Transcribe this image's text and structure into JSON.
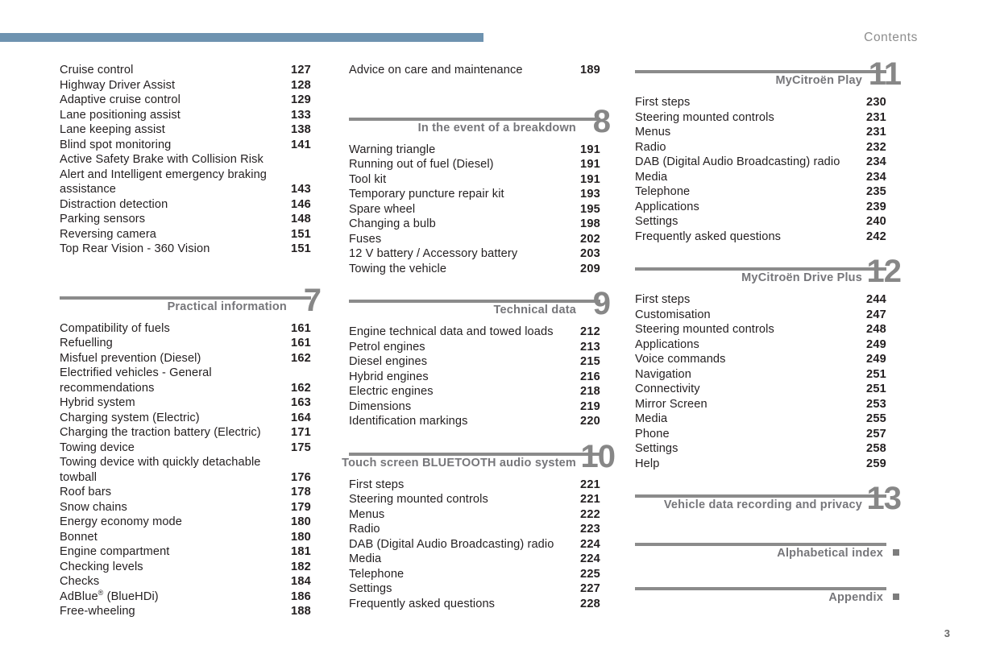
{
  "header": {
    "title": "Contents",
    "bar_color": "#6e93b0"
  },
  "footer": {
    "page_number": "3"
  },
  "columns": [
    {
      "id": "column-1",
      "blocks": [
        {
          "type": "entries",
          "entries": [
            {
              "label": "Cruise control",
              "page": "127"
            },
            {
              "label": "Highway Driver Assist",
              "page": "128"
            },
            {
              "label": "Adaptive cruise control",
              "page": "129"
            },
            {
              "label": "Lane positioning assist",
              "page": "133"
            },
            {
              "label": "Lane keeping assist",
              "page": "138"
            },
            {
              "label": "Blind spot monitoring",
              "page": "141"
            },
            {
              "label": "Active Safety Brake with Collision Risk",
              "page": ""
            },
            {
              "label": "Alert and Intelligent emergency braking",
              "page": ""
            },
            {
              "label": "assistance",
              "page": "143"
            },
            {
              "label": "Distraction detection",
              "page": "146"
            },
            {
              "label": "Parking sensors",
              "page": "148"
            },
            {
              "label": "Reversing camera",
              "page": "151"
            },
            {
              "label": "Top Rear Vision - 360 Vision",
              "page": "151"
            }
          ]
        },
        {
          "type": "chapter",
          "title": "Practical information",
          "number": "7",
          "entries": [
            {
              "label": "Compatibility of fuels",
              "page": "161"
            },
            {
              "label": "Refuelling",
              "page": "161"
            },
            {
              "label": "Misfuel prevention (Diesel)",
              "page": "162"
            },
            {
              "label": "Electrified vehicles - General",
              "page": ""
            },
            {
              "label": "recommendations",
              "page": "162"
            },
            {
              "label": "Hybrid system",
              "page": "163"
            },
            {
              "label": "Charging system (Electric)",
              "page": "164"
            },
            {
              "label": "Charging the traction battery (Electric)",
              "page": "171"
            },
            {
              "label": "Towing device",
              "page": "175"
            },
            {
              "label": "Towing device with quickly detachable",
              "page": ""
            },
            {
              "label": "towball",
              "page": "176"
            },
            {
              "label": "Roof bars",
              "page": "178"
            },
            {
              "label": "Snow chains",
              "page": "179"
            },
            {
              "label": "Energy economy mode",
              "page": "180"
            },
            {
              "label": "Bonnet",
              "page": "180"
            },
            {
              "label": "Engine compartment",
              "page": "181"
            },
            {
              "label": "Checking levels",
              "page": "182"
            },
            {
              "label": "Checks",
              "page": "184"
            },
            {
              "label": "AdBlue® (BlueHDi)",
              "page": "186",
              "html": "AdBlue<sup>®</sup> (BlueHDi)"
            },
            {
              "label": "Free-wheeling",
              "page": "188"
            }
          ]
        }
      ]
    },
    {
      "id": "column-2",
      "blocks": [
        {
          "type": "entries",
          "entries": [
            {
              "label": "Advice on care and maintenance",
              "page": "189"
            }
          ]
        },
        {
          "type": "chapter",
          "title": "In the event of a breakdown",
          "number": "8",
          "entries": [
            {
              "label": "Warning triangle",
              "page": "191"
            },
            {
              "label": "Running out of fuel (Diesel)",
              "page": "191"
            },
            {
              "label": "Tool kit",
              "page": "191"
            },
            {
              "label": "Temporary puncture repair kit",
              "page": "193"
            },
            {
              "label": "Spare wheel",
              "page": "195"
            },
            {
              "label": "Changing a bulb",
              "page": "198"
            },
            {
              "label": "Fuses",
              "page": "202"
            },
            {
              "label": "12 V battery / Accessory battery",
              "page": "203"
            },
            {
              "label": "Towing the vehicle",
              "page": "209"
            }
          ]
        },
        {
          "type": "chapter",
          "title": "Technical data",
          "number": "9",
          "entries": [
            {
              "label": "Engine technical data and towed loads",
              "page": "212"
            },
            {
              "label": "Petrol engines",
              "page": "213"
            },
            {
              "label": "Diesel engines",
              "page": "215"
            },
            {
              "label": "Hybrid engines",
              "page": "216"
            },
            {
              "label": "Electric engines",
              "page": "218"
            },
            {
              "label": "Dimensions",
              "page": "219"
            },
            {
              "label": "Identification markings",
              "page": "220"
            }
          ]
        },
        {
          "type": "chapter",
          "title": "Touch screen BLUETOOTH audio system",
          "number": "10",
          "entries": [
            {
              "label": "First steps",
              "page": "221"
            },
            {
              "label": "Steering mounted controls",
              "page": "221"
            },
            {
              "label": "Menus",
              "page": "222"
            },
            {
              "label": "Radio",
              "page": "223"
            },
            {
              "label": "DAB (Digital Audio Broadcasting) radio",
              "page": "224"
            },
            {
              "label": "Media",
              "page": "224"
            },
            {
              "label": "Telephone",
              "page": "225"
            },
            {
              "label": "Settings",
              "page": "227"
            },
            {
              "label": "Frequently asked questions",
              "page": "228"
            }
          ]
        }
      ]
    },
    {
      "id": "column-3",
      "blocks": [
        {
          "type": "chapter",
          "title": "MyCitroën Play",
          "number": "11",
          "entries": [
            {
              "label": "First steps",
              "page": "230"
            },
            {
              "label": "Steering mounted controls",
              "page": "231"
            },
            {
              "label": "Menus",
              "page": "231"
            },
            {
              "label": "Radio",
              "page": "232"
            },
            {
              "label": "DAB (Digital Audio Broadcasting) radio",
              "page": "234"
            },
            {
              "label": "Media",
              "page": "234"
            },
            {
              "label": "Telephone",
              "page": "235"
            },
            {
              "label": "Applications",
              "page": "239"
            },
            {
              "label": "Settings",
              "page": "240"
            },
            {
              "label": "Frequently asked questions",
              "page": "242"
            }
          ]
        },
        {
          "type": "chapter",
          "title": "MyCitroën Drive Plus",
          "number": "12",
          "entries": [
            {
              "label": "First steps",
              "page": "244"
            },
            {
              "label": "Customisation",
              "page": "247"
            },
            {
              "label": "Steering mounted controls",
              "page": "248"
            },
            {
              "label": "Applications",
              "page": "249"
            },
            {
              "label": "Voice commands",
              "page": "249"
            },
            {
              "label": "Navigation",
              "page": "251"
            },
            {
              "label": "Connectivity",
              "page": "251"
            },
            {
              "label": "Mirror Screen",
              "page": "253"
            },
            {
              "label": "Media",
              "page": "255"
            },
            {
              "label": "Phone",
              "page": "257"
            },
            {
              "label": "Settings",
              "page": "258"
            },
            {
              "label": "Help",
              "page": "259"
            }
          ]
        },
        {
          "type": "chapter",
          "title": "Vehicle data recording and privacy",
          "number": "13",
          "entries": []
        },
        {
          "type": "chapter",
          "title": "Alphabetical index",
          "number": "",
          "marker": true,
          "entries": []
        },
        {
          "type": "chapter",
          "title": "Appendix",
          "number": "",
          "marker": true,
          "entries": []
        }
      ]
    }
  ]
}
